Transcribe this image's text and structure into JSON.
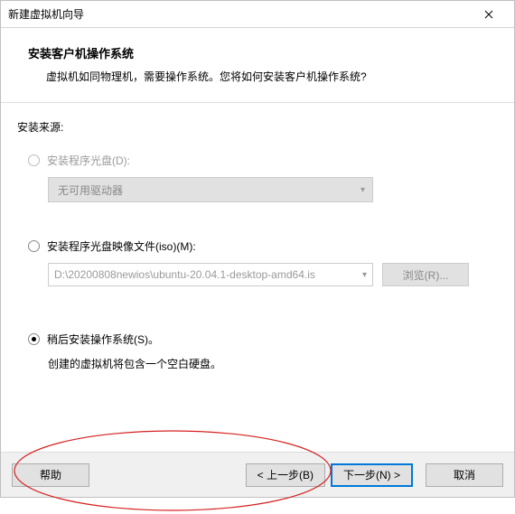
{
  "titlebar": {
    "title": "新建虚拟机向导"
  },
  "header": {
    "title": "安装客户机操作系统",
    "desc": "虚拟机如同物理机，需要操作系统。您将如何安装客户机操作系统?"
  },
  "body": {
    "source_label": "安装来源:",
    "opt1": {
      "label": "安装程序光盘(D):",
      "combo": "无可用驱动器"
    },
    "opt2": {
      "label": "安装程序光盘映像文件(iso)(M):",
      "path": "D:\\20200808newios\\ubuntu-20.04.1-desktop-amd64.is",
      "browse": "浏览(R)..."
    },
    "opt3": {
      "label": "稍后安装操作系统(S)。",
      "desc": "创建的虚拟机将包含一个空白硬盘。"
    }
  },
  "footer": {
    "help": "帮助",
    "back": "< 上一步(B)",
    "next": "下一步(N) >",
    "cancel": "取消"
  }
}
